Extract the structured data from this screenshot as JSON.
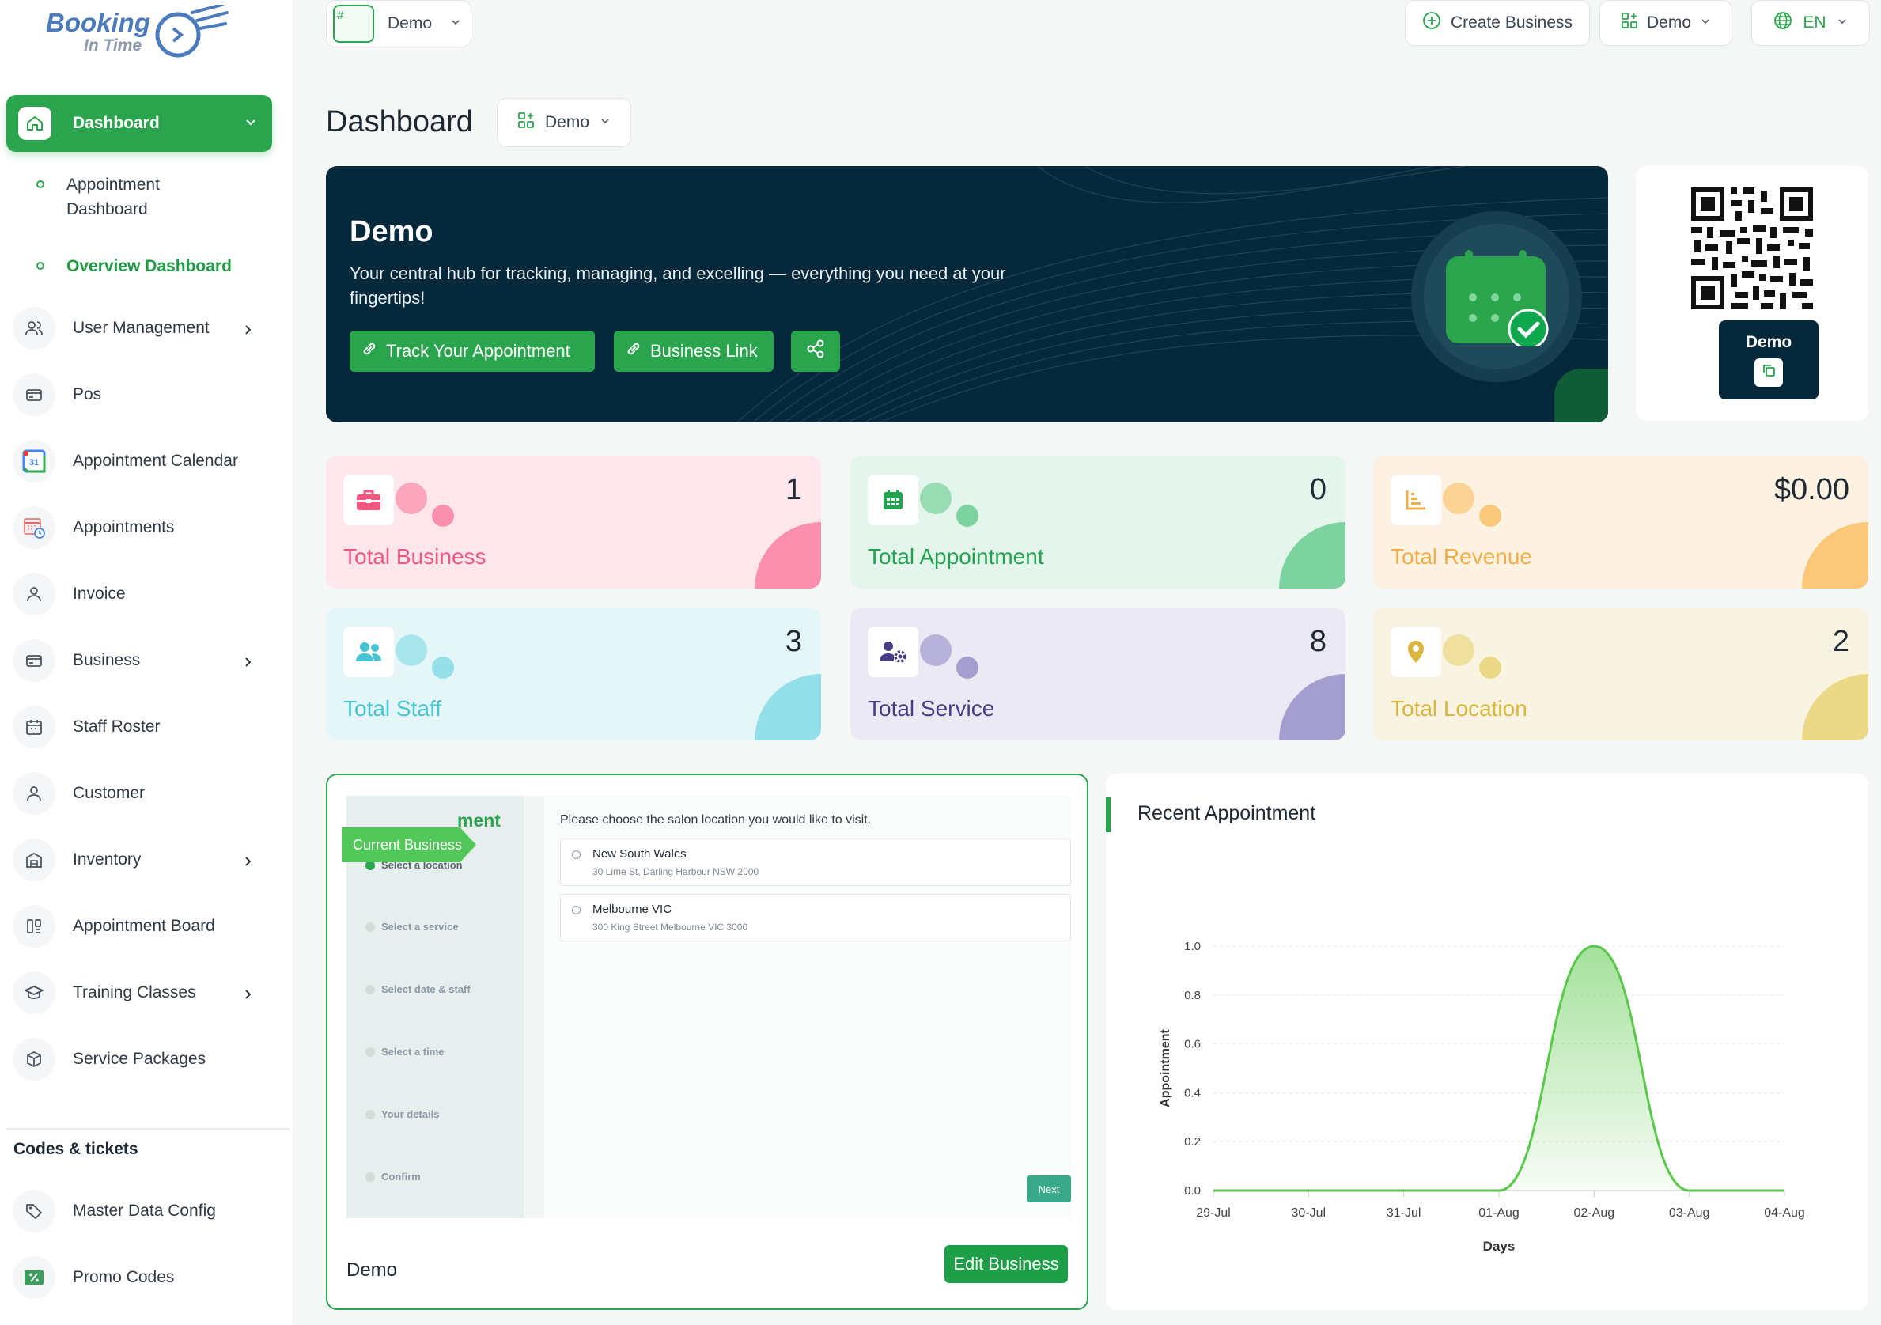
{
  "logo": {
    "line1": "Booking",
    "line2": "In Time"
  },
  "sidebar": {
    "active": {
      "label": "Dashboard"
    },
    "sub_items": [
      {
        "label": "Appointment Dashboard"
      },
      {
        "label": "Overview Dashboard"
      }
    ],
    "items": [
      {
        "label": "User Management",
        "icon": "users-icon"
      },
      {
        "label": "Pos",
        "icon": "card-icon"
      },
      {
        "label": "Appointment Calendar",
        "icon": "google-calendar-icon",
        "badge": "31"
      },
      {
        "label": "Appointments",
        "icon": "calendar-clock-icon"
      },
      {
        "label": "Invoice",
        "icon": "user-icon"
      },
      {
        "label": "Business",
        "icon": "card-icon"
      },
      {
        "label": "Staff Roster",
        "icon": "calendar-icon"
      },
      {
        "label": "Customer",
        "icon": "user-icon"
      },
      {
        "label": "Inventory",
        "icon": "warehouse-icon"
      },
      {
        "label": "Appointment Board",
        "icon": "board-icon"
      },
      {
        "label": "Training Classes",
        "icon": "graduation-cap-icon"
      },
      {
        "label": "Service Packages",
        "icon": "package-icon"
      }
    ],
    "section_heading": "Codes & tickets",
    "section_items": [
      {
        "label": "Master Data Config",
        "icon": "tag-icon"
      },
      {
        "label": "Promo Codes",
        "icon": "percent-icon"
      }
    ]
  },
  "topbar": {
    "business_selector": "Demo",
    "business_image_alt": "#",
    "create_business": "Create Business",
    "demo_selector": "Demo",
    "language": "EN"
  },
  "page": {
    "title": "Dashboard",
    "selector": "Demo"
  },
  "hero": {
    "title": "Demo",
    "subtitle": "Your central hub for tracking, managing, and excelling — everything you need at your fingertips!",
    "track_button": "Track Your Appointment",
    "business_link": "Business Link"
  },
  "qr": {
    "label": "Demo"
  },
  "stats": [
    {
      "name": "Total Business",
      "value": "1",
      "bg": "#fde7ec",
      "accent": "#f2577f",
      "blob": "#fa90ad",
      "icon": "briefcase-icon"
    },
    {
      "name": "Total Appointment",
      "value": "0",
      "bg": "#e4f5ec",
      "accent": "#21a34f",
      "blob": "#7dd3a0",
      "icon": "calendar-grid-icon"
    },
    {
      "name": "Total Revenue",
      "value": "$0.00",
      "bg": "#fdf2e2",
      "accent": "#f4ae46",
      "blob": "#fbc87a",
      "icon": "bar-chart-icon"
    },
    {
      "name": "Total Staff",
      "value": "3",
      "bg": "#e5f6f8",
      "accent": "#47c4d4",
      "blob": "#93e0e8",
      "icon": "staff-group-icon"
    },
    {
      "name": "Total Service",
      "value": "8",
      "bg": "#ebe9f3",
      "accent": "#473e86",
      "blob": "#a59fd0",
      "icon": "user-gear-icon"
    },
    {
      "name": "Total Location",
      "value": "2",
      "bg": "#f9f3e1",
      "accent": "#dab73c",
      "blob": "#ecd987",
      "icon": "location-pin-icon"
    }
  ],
  "business_card": {
    "name": "Demo",
    "edit_button": "Edit Business",
    "preview": {
      "header_fragment": "ment",
      "tag": "Current Business",
      "steps": [
        "Select a location",
        "Select a service",
        "Select date & staff",
        "Select a time",
        "Your details",
        "Confirm"
      ],
      "question": "Please choose the salon location you would like to visit.",
      "locations": [
        {
          "name": "New South Wales",
          "address": "30 Lime St, Darling Harbour NSW 2000"
        },
        {
          "name": "Melbourne VIC",
          "address": "300 King Street Melbourne VIC 3000"
        }
      ],
      "next": "Next"
    }
  },
  "chart_card": {
    "title": "Recent Appointment"
  },
  "chart_data": {
    "type": "area",
    "x": [
      "29-Jul",
      "30-Jul",
      "31-Jul",
      "01-Aug",
      "02-Aug",
      "03-Aug",
      "04-Aug"
    ],
    "values": [
      0,
      0,
      0,
      0,
      1,
      0,
      0
    ],
    "xlabel": "Days",
    "ylabel": "Appointment",
    "ylim": [
      0,
      1
    ],
    "yticks": [
      "0.0",
      "0.2",
      "0.4",
      "0.6",
      "0.8",
      "1.0"
    ],
    "grid": true,
    "color": "#5ac84a"
  }
}
